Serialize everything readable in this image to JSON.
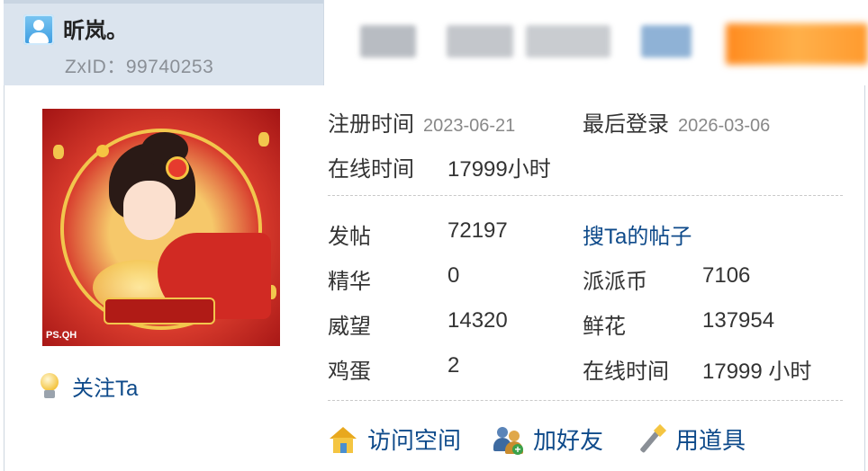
{
  "header": {
    "username": "昕岚。",
    "user_id": "ZxID：99740253"
  },
  "profile": {
    "avatar_watermark": "PS.QH",
    "follow_label": "关注Ta"
  },
  "info": {
    "register_label": "注册时间",
    "register_date": "2023-06-21",
    "last_login_label": "最后登录",
    "last_login_date": "2026-03-06",
    "online_label": "在线时间",
    "online_value": "17999小时"
  },
  "stats": {
    "posts_label": "发帖",
    "posts_value": "72197",
    "search_posts_link": "搜Ta的帖子",
    "essence_label": "精华",
    "essence_value": "0",
    "coins_label": "派派币",
    "coins_value": "7106",
    "prestige_label": "威望",
    "prestige_value": "14320",
    "flowers_label": "鲜花",
    "flowers_value": "137954",
    "eggs_label": "鸡蛋",
    "eggs_value": "2",
    "online_time_label": "在线时间",
    "online_time_value": "17999 小时"
  },
  "actions": {
    "visit_space": "访问空间",
    "add_friend": "加好友",
    "use_item": "用道具"
  },
  "icons": {
    "user_avatar": "user-avatar-icon",
    "follow": "lightbulb-icon",
    "visit_space": "house-icon",
    "add_friend": "add-friend-icon",
    "use_item": "magic-wand-icon"
  },
  "colors": {
    "link": "#0e4a8a",
    "header_bg": "#dbe4ee",
    "muted_text": "#888888"
  }
}
